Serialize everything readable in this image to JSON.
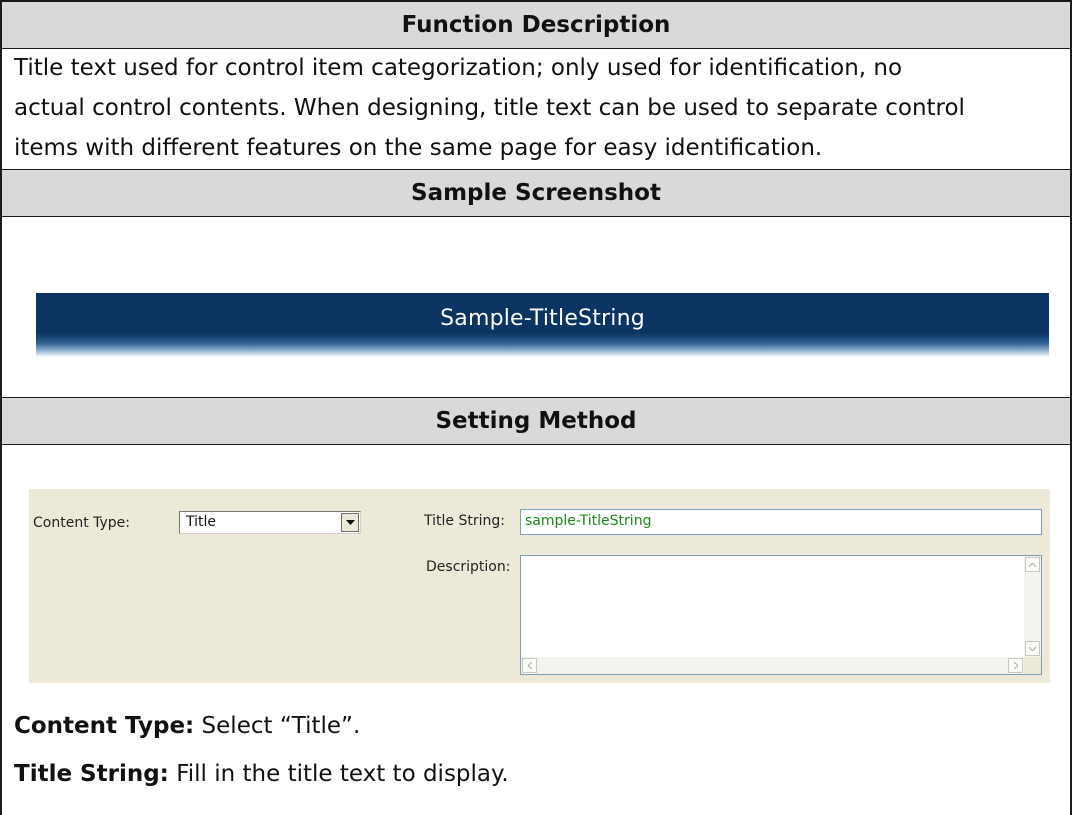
{
  "sections": {
    "function_description": {
      "header": "Function Description",
      "lines": [
        "Title text used for control item categorization; only used for identification, no",
        "actual control contents. When designing, title text can be used to separate control",
        "items with different features on the same page for easy identification."
      ]
    },
    "sample_screenshot": {
      "header": "Sample Screenshot",
      "banner_text": "Sample-TitleString",
      "banner_color": "#0b3462"
    },
    "setting_method": {
      "header": "Setting Method",
      "panel": {
        "content_type_label": "Content Type:",
        "content_type_value": "Title",
        "title_string_label": "Title String:",
        "title_string_value": "sample-TitleString",
        "description_label": "Description:",
        "description_value": "",
        "value_color": "#1a8a1a",
        "panel_color": "#ece9d8"
      },
      "notes": [
        {
          "term": "Content Type:",
          "text": " Select “Title”."
        },
        {
          "term": "Title String:",
          "text": " Fill in the title text to display."
        }
      ]
    }
  },
  "header_color": "#d9d9d9"
}
